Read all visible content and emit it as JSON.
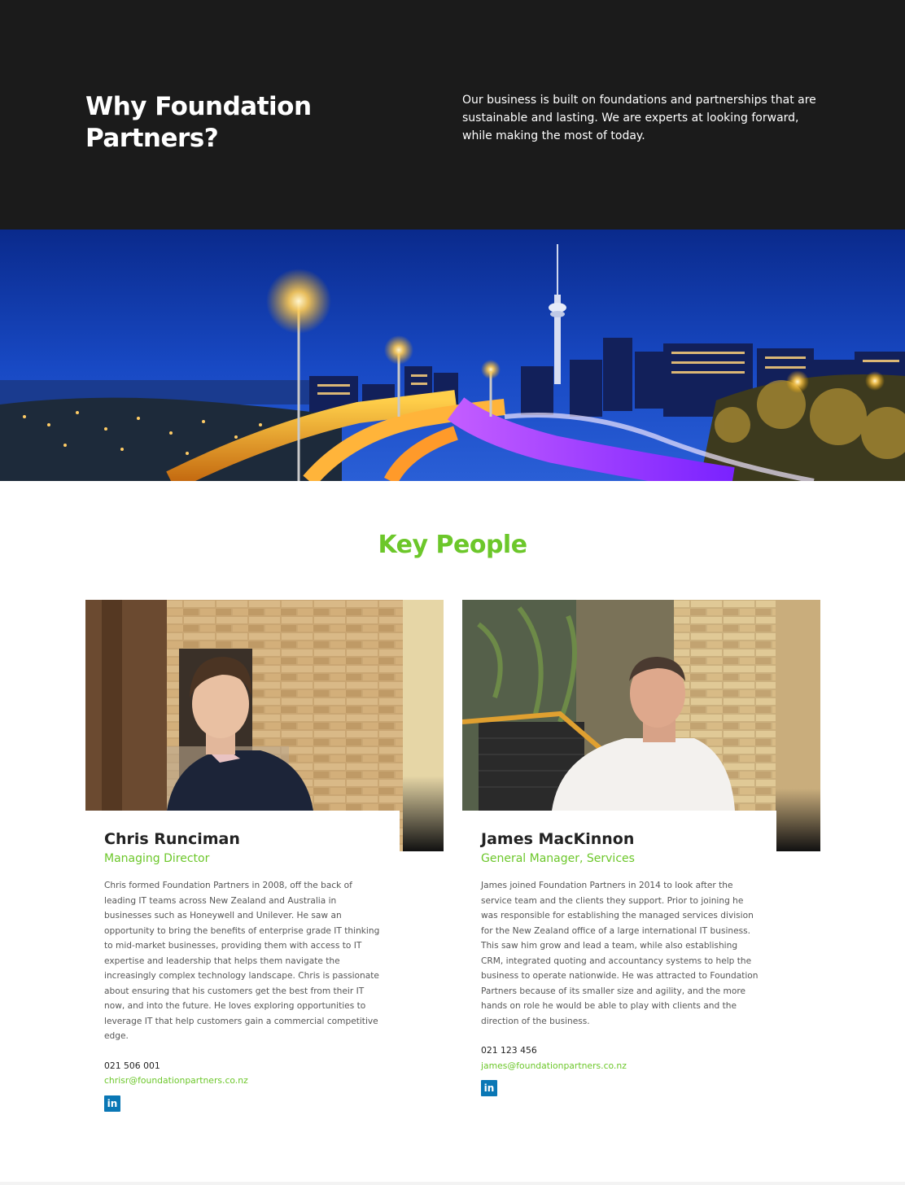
{
  "hero": {
    "title": "Why Foundation Partners?",
    "text": "Our business is built on foundations and partnerships that are sustainable and lasting. We are experts at looking forward, while making the most of today."
  },
  "key_people": {
    "title": "Key People",
    "people": [
      {
        "name": "Chris Runciman",
        "role": "Managing Director",
        "bio": "Chris formed Foundation Partners in 2008, off the back of leading IT teams across New Zealand and Australia in businesses such as Honeywell and Unilever. He saw an opportunity to bring the benefits of enterprise grade IT thinking to mid-market businesses, providing them with access to IT expertise and leadership that helps them navigate the increasingly complex technology landscape. Chris is passionate about ensuring that his customers get the best from their IT now, and into the future. He loves exploring opportunities to leverage IT that help customers gain a commercial competitive edge.",
        "phone": "021 506 001",
        "email": "chrisr@foundationpartners.co.nz",
        "linkedin_icon": "linkedin-icon"
      },
      {
        "name": "James MacKinnon",
        "role": "General Manager, Services",
        "bio": "James joined Foundation Partners in 2014 to look after the service team and the clients they support. Prior to joining he was responsible for establishing the managed services division for the New Zealand office of a large international IT business. This saw him grow and lead a team, while also establishing CRM, integrated quoting and accountancy systems to help the business to operate nationwide. He was attracted to Foundation Partners because of its smaller size and agility, and the more hands on role he would be able to play with clients and the direction of the business.",
        "phone": "021 123 456",
        "email": "james@foundationpartners.co.nz",
        "linkedin_icon": "linkedin-icon"
      }
    ]
  },
  "colors": {
    "accent_green": "#6cc72a",
    "hero_bg": "#1b1b1b",
    "linkedin_blue": "#0a77b5"
  }
}
